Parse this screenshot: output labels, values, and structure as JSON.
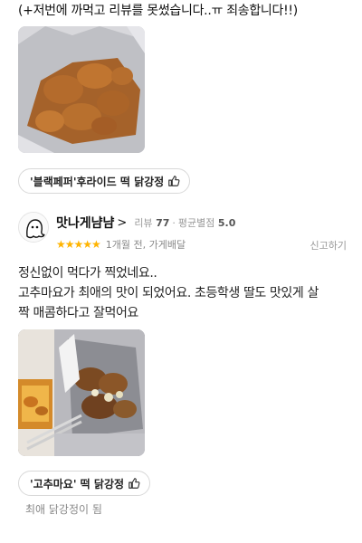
{
  "previous_review": {
    "text_tail": "(+저번에 까먹고 리뷰를 못썼습니다..ㅠ 죄송합니다!!)",
    "menu_chip": "'블랙페퍼'후라이드 떡 닭강정"
  },
  "review": {
    "nickname": "맛나게냠냠",
    "nick_chevron": ">",
    "review_label": "리뷰",
    "review_count": "77",
    "avg_label": "평균별점",
    "avg_rating": "5.0",
    "stars": "★★★★★",
    "rating": 5,
    "when": "1개월 전, 가게배달",
    "report_label": "신고하기",
    "body_lines": [
      "정신없이 먹다가 찍었네요..",
      "고추마요가 최애의 맛이 되었어요. 초등학생 딸도 맛있게 살",
      "짝 매콤하다고 잘먹어요"
    ],
    "menu_chip": "'고추마요' 떡 닭강정",
    "owner_footer": "최애 닭강정이 됨"
  },
  "colors": {
    "star": "#ffb400",
    "meta_gray": "#999999"
  },
  "icons": {
    "thumb": "thumbs-up-icon",
    "avatar": "ghost-character-avatar"
  }
}
